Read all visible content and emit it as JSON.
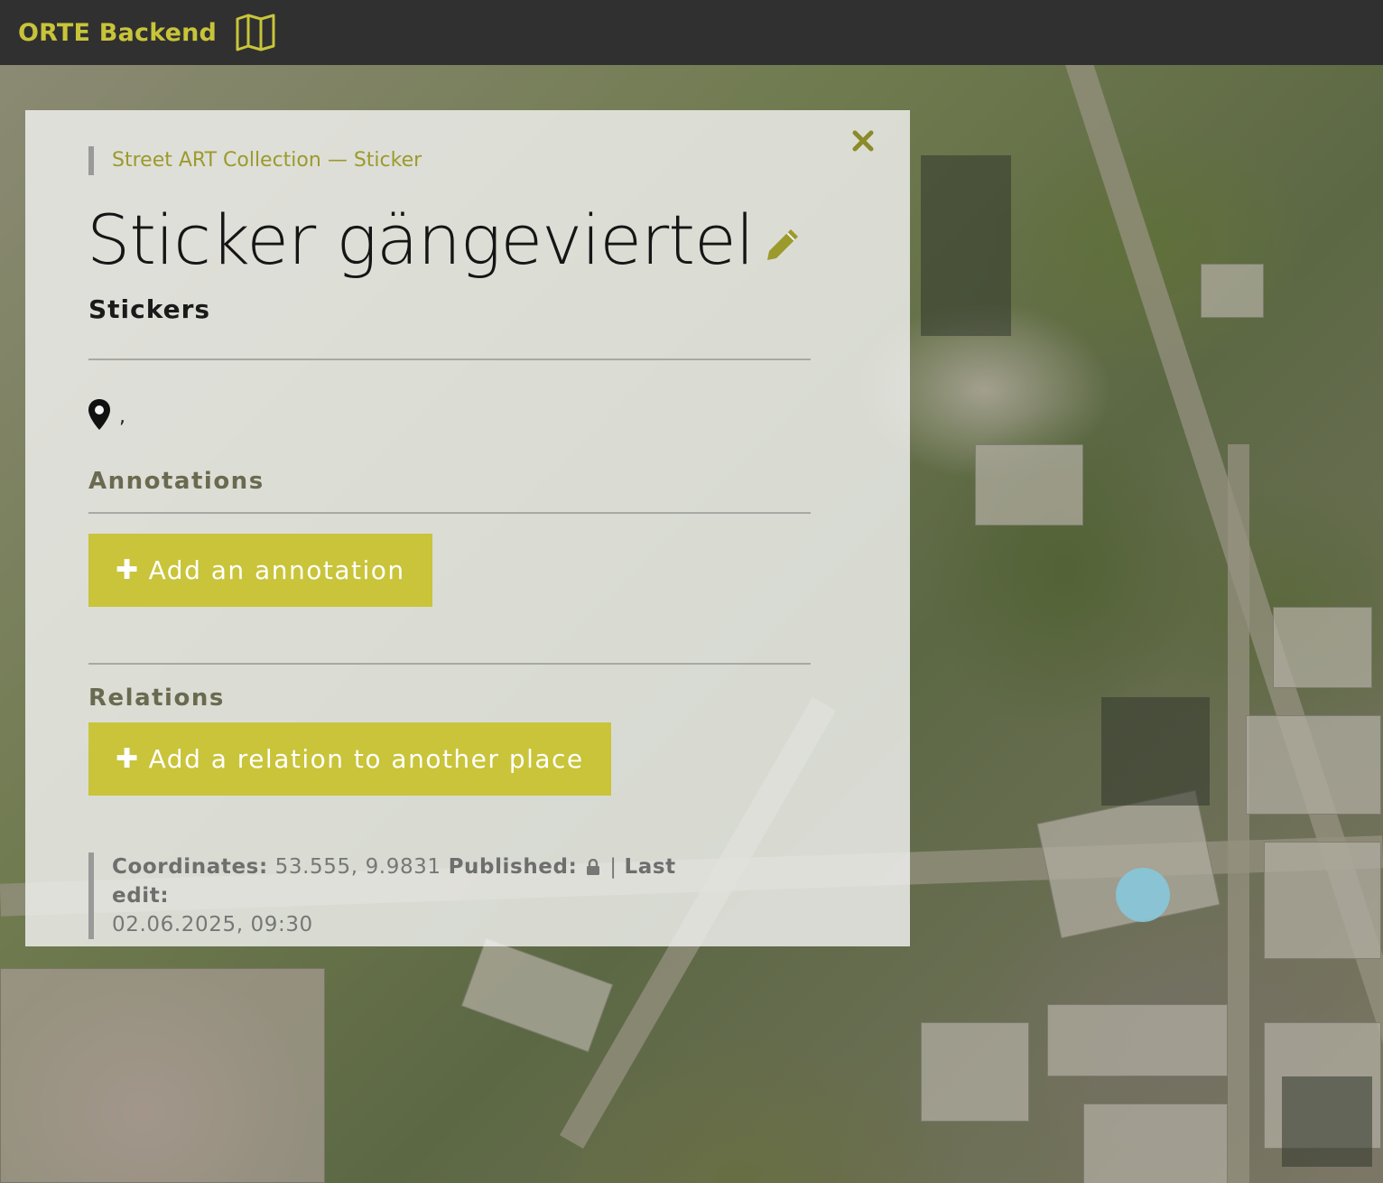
{
  "navbar": {
    "brand": "ORTE Backend",
    "brand_icon": "map-icon",
    "accent_color": "#c8c43a",
    "background_color": "#303030"
  },
  "panel": {
    "close_icon": "close-icon",
    "breadcrumb": {
      "collection": "Street ART Collection",
      "separator": " — ",
      "category": "Sticker"
    },
    "title": "Sticker gängeviertel",
    "edit_icon": "pencil-icon",
    "subtitle": "Stickers",
    "location_icon": "map-marker-icon",
    "location_text": ",",
    "annotations_heading": "Annotations",
    "add_annotation_label": "Add an annotation",
    "relations_heading": "Relations",
    "add_relation_label": "Add a relation to another place",
    "meta": {
      "coordinates_label": "Coordinates:",
      "coordinates_value": "53.555, 9.9831",
      "published_label": "Published:",
      "published_icon": "lock-icon",
      "separator": "|",
      "last_edit_label": "Last edit:",
      "last_edit_value": "02.06.2025, 09:30"
    },
    "button_color": "#c9c43a"
  },
  "map": {
    "type": "satellite",
    "marker_color": "#86c8dc"
  }
}
